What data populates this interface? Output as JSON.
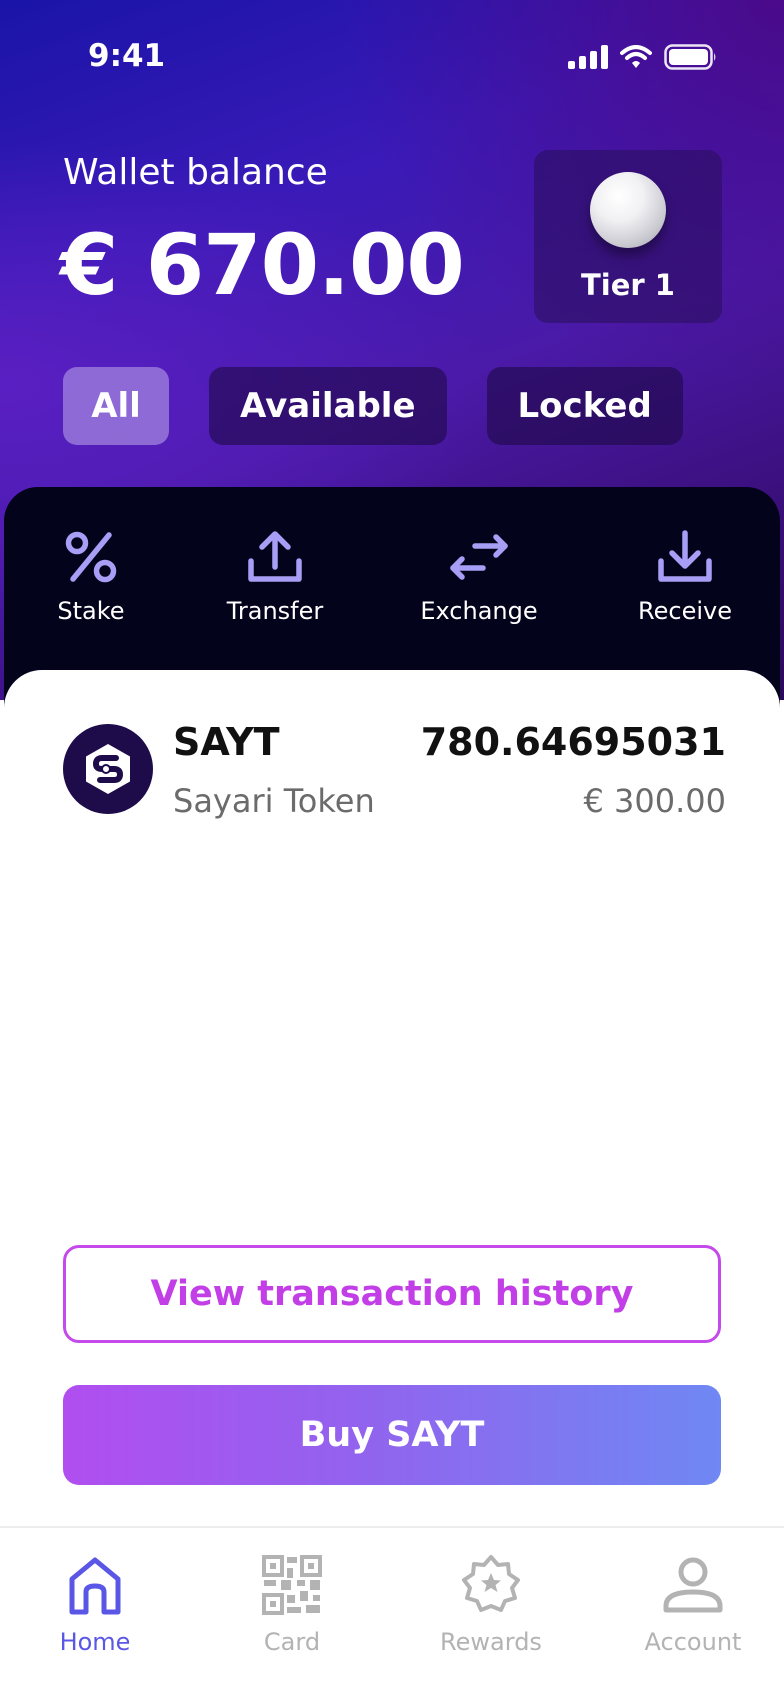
{
  "status_bar": {
    "time": "9:41"
  },
  "wallet": {
    "balance_label": "Wallet balance",
    "balance_amount": "€ 670.00",
    "tier_label": "Tier 1"
  },
  "filters": [
    {
      "label": "All",
      "selected": true
    },
    {
      "label": "Available",
      "selected": false
    },
    {
      "label": "Locked",
      "selected": false
    }
  ],
  "actions": [
    {
      "label": "Stake",
      "icon": "percent-icon"
    },
    {
      "label": "Transfer",
      "icon": "upload-icon"
    },
    {
      "label": "Exchange",
      "icon": "exchange-arrows-icon"
    },
    {
      "label": "Receive",
      "icon": "download-icon"
    }
  ],
  "token": {
    "symbol": "SAYT",
    "name": "Sayari Token",
    "amount": "780.64695031",
    "fiat_value": "€ 300.00"
  },
  "buttons": {
    "history_label": "View transaction history",
    "buy_label": "Buy SAYT"
  },
  "nav": [
    {
      "label": "Home",
      "icon": "home-icon",
      "active": true
    },
    {
      "label": "Card",
      "icon": "qr-code-icon",
      "active": false
    },
    {
      "label": "Rewards",
      "icon": "rewards-badge-icon",
      "active": false
    },
    {
      "label": "Account",
      "icon": "user-icon",
      "active": false
    }
  ],
  "colors": {
    "accent": "#5b57e6",
    "action_icon": "#a79ff5",
    "history_border": "#c44bea",
    "buy_gradient_start": "#b14ef0",
    "buy_gradient_end": "#6f88f3",
    "actions_panel": "#04031c"
  }
}
